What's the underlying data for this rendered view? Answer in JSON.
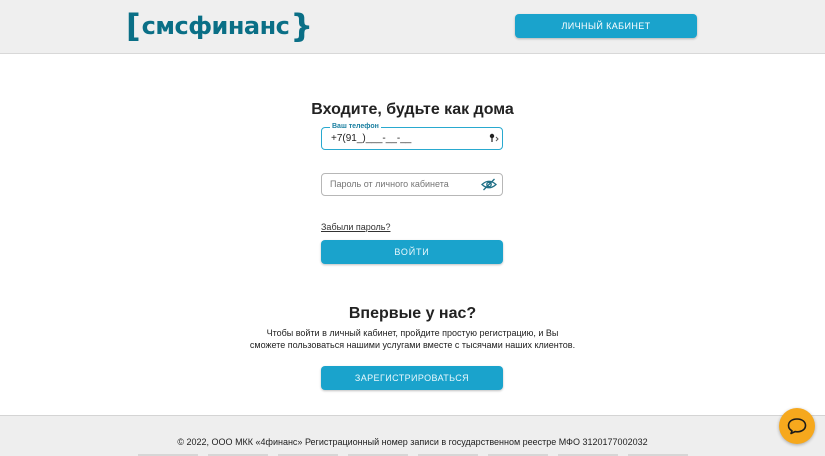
{
  "header": {
    "logo_text": "смсфинанс",
    "cabinet_button": "ЛИЧНЫЙ КАБИНЕТ"
  },
  "login": {
    "title": "Входите, будьте как дома",
    "phone_label": "Ваш телефон",
    "phone_value": "+7(91_)___-__-__",
    "password_placeholder": "Пароль от личного кабинета",
    "forgot_link": "Забыли пароль?",
    "submit_button": "ВОЙТИ"
  },
  "register": {
    "title": "Впервые у нас?",
    "text_line1": "Чтобы войти в личный кабинет, пройдите простую регистрацию, и Вы",
    "text_line2": "сможете пользоваться нашими услугами вместе с тысячами наших клиентов.",
    "button": "ЗАРЕГИСТРИРОВАТЬСЯ"
  },
  "footer": {
    "copyright": "© 2022, ООО МКК «4финанс» Регистрационный номер записи в государственном реестре МФО 3120177002032"
  },
  "icons": {
    "key": "key-icon",
    "eye": "eye-slash-icon",
    "chat": "chat-icon"
  },
  "colors": {
    "brand": "#0a6f86",
    "accent": "#1aa3cc",
    "chat": "#f6a81d"
  }
}
